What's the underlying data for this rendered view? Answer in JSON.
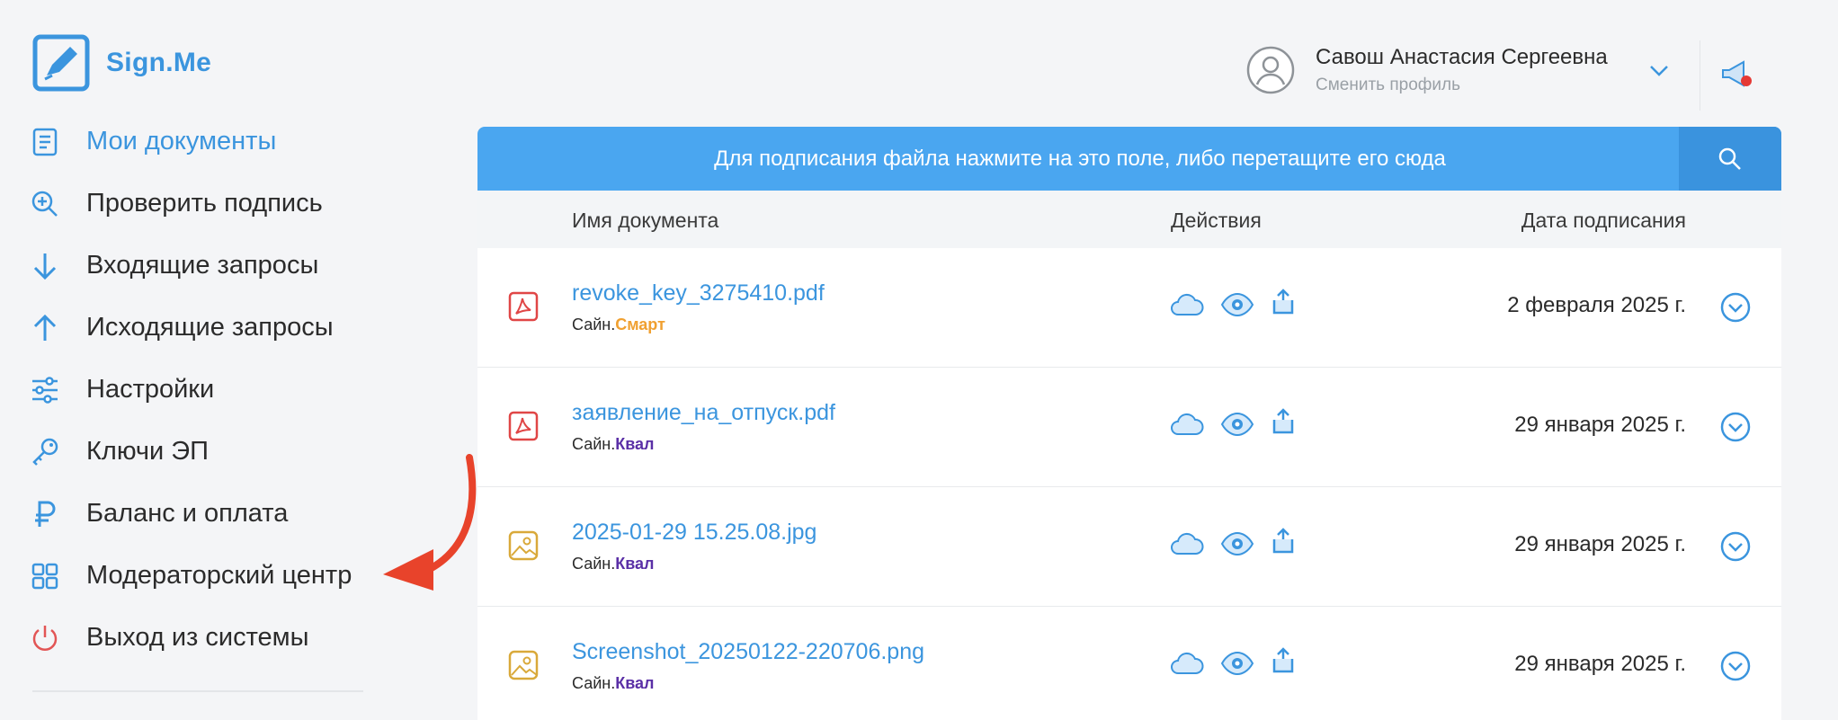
{
  "app": {
    "name": "Sign.Me"
  },
  "sidebar": {
    "items": [
      {
        "label": "Мои документы",
        "icon": "document-icon",
        "active": true
      },
      {
        "label": "Проверить подпись",
        "icon": "zoom-in-icon"
      },
      {
        "label": "Входящие запросы",
        "icon": "arrow-down-icon"
      },
      {
        "label": "Исходящие запросы",
        "icon": "arrow-up-icon"
      },
      {
        "label": "Настройки",
        "icon": "sliders-icon"
      },
      {
        "label": "Ключи ЭП",
        "icon": "key-icon"
      },
      {
        "label": "Баланс и оплата",
        "icon": "ruble-icon"
      },
      {
        "label": "Модераторский центр",
        "icon": "grid-icon"
      },
      {
        "label": "Выход из системы",
        "icon": "power-icon"
      }
    ]
  },
  "header": {
    "profile_name": "Савош Анастасия Сергеевна",
    "profile_sub": "Сменить профиль"
  },
  "main": {
    "dropzone_text": "Для подписания файла нажмите на это поле, либо перетащите его сюда",
    "columns": {
      "name": "Имя документа",
      "actions": "Действия",
      "date": "Дата подписания"
    },
    "rows": [
      {
        "name": "revoke_key_3275410.pdf",
        "prefix": "Сайн.",
        "type": "Смарт",
        "type_style": "smart",
        "icon": "pdf-icon",
        "date": "2 февраля 2025 г."
      },
      {
        "name": "заявление_на_отпуск.pdf",
        "prefix": "Сайн.",
        "type": "Квал",
        "type_style": "kval",
        "icon": "pdf-icon",
        "date": "29 января 2025 г."
      },
      {
        "name": "2025-01-29 15.25.08.jpg",
        "prefix": "Сайн.",
        "type": "Квал",
        "type_style": "kval",
        "icon": "image-icon",
        "date": "29 января 2025 г."
      },
      {
        "name": "Screenshot_20250122-220706.png",
        "prefix": "Сайн.",
        "type": "Квал",
        "type_style": "kval",
        "icon": "image-icon",
        "date": "29 января 2025 г."
      }
    ]
  },
  "colors": {
    "accent": "#3b95de",
    "dropzone": "#4aa6f0",
    "smart": "#f0a030",
    "kval": "#5a2fa6",
    "pdf": "#e04646",
    "image": "#d9a93a",
    "annotation": "#e8432b",
    "logout": "#e25555"
  }
}
